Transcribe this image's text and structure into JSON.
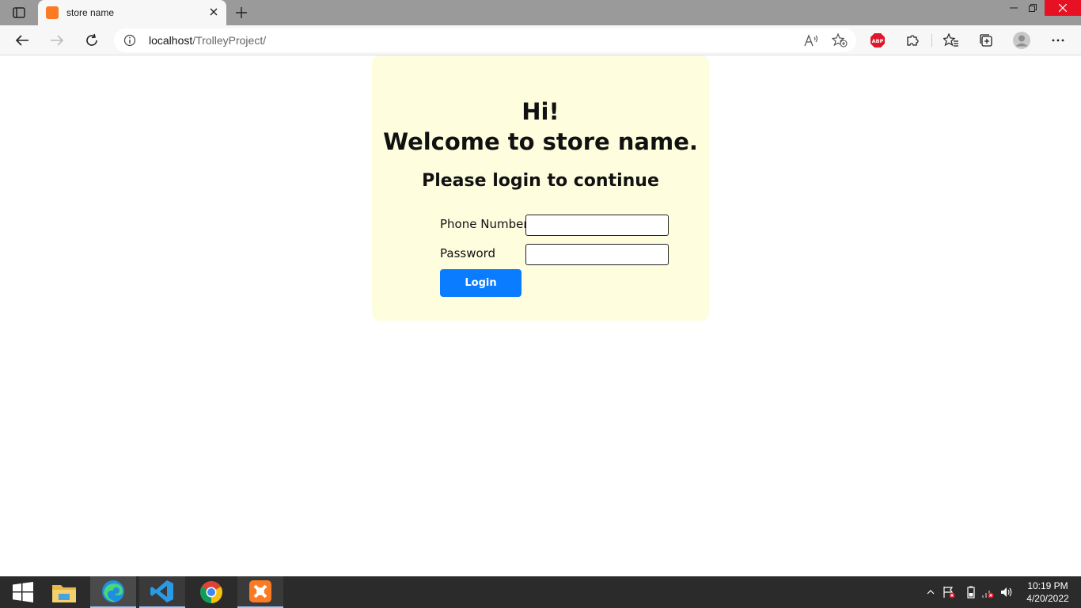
{
  "browser": {
    "tab": {
      "title": "store name"
    },
    "address": {
      "host": "localhost",
      "path": "/TrolleyProject/"
    }
  },
  "page": {
    "greeting_line1": "Hi!",
    "greeting_line2": "Welcome to store name.",
    "subheading": "Please login to continue",
    "form": {
      "phone_label": "Phone Number",
      "phone_value": "",
      "password_label": "Password",
      "password_value": "",
      "login_label": "Login"
    }
  },
  "taskbar": {
    "apps": [
      "file-explorer",
      "microsoft-edge",
      "visual-studio-code",
      "google-chrome",
      "xampp"
    ],
    "clock": {
      "time": "10:19 PM",
      "date": "4/20/2022"
    }
  },
  "colors": {
    "card_bg": "#fefdde",
    "login_button": "#0a7cff",
    "tab_strip": "#9a9a9a",
    "taskbar": "#2b2b2b"
  }
}
